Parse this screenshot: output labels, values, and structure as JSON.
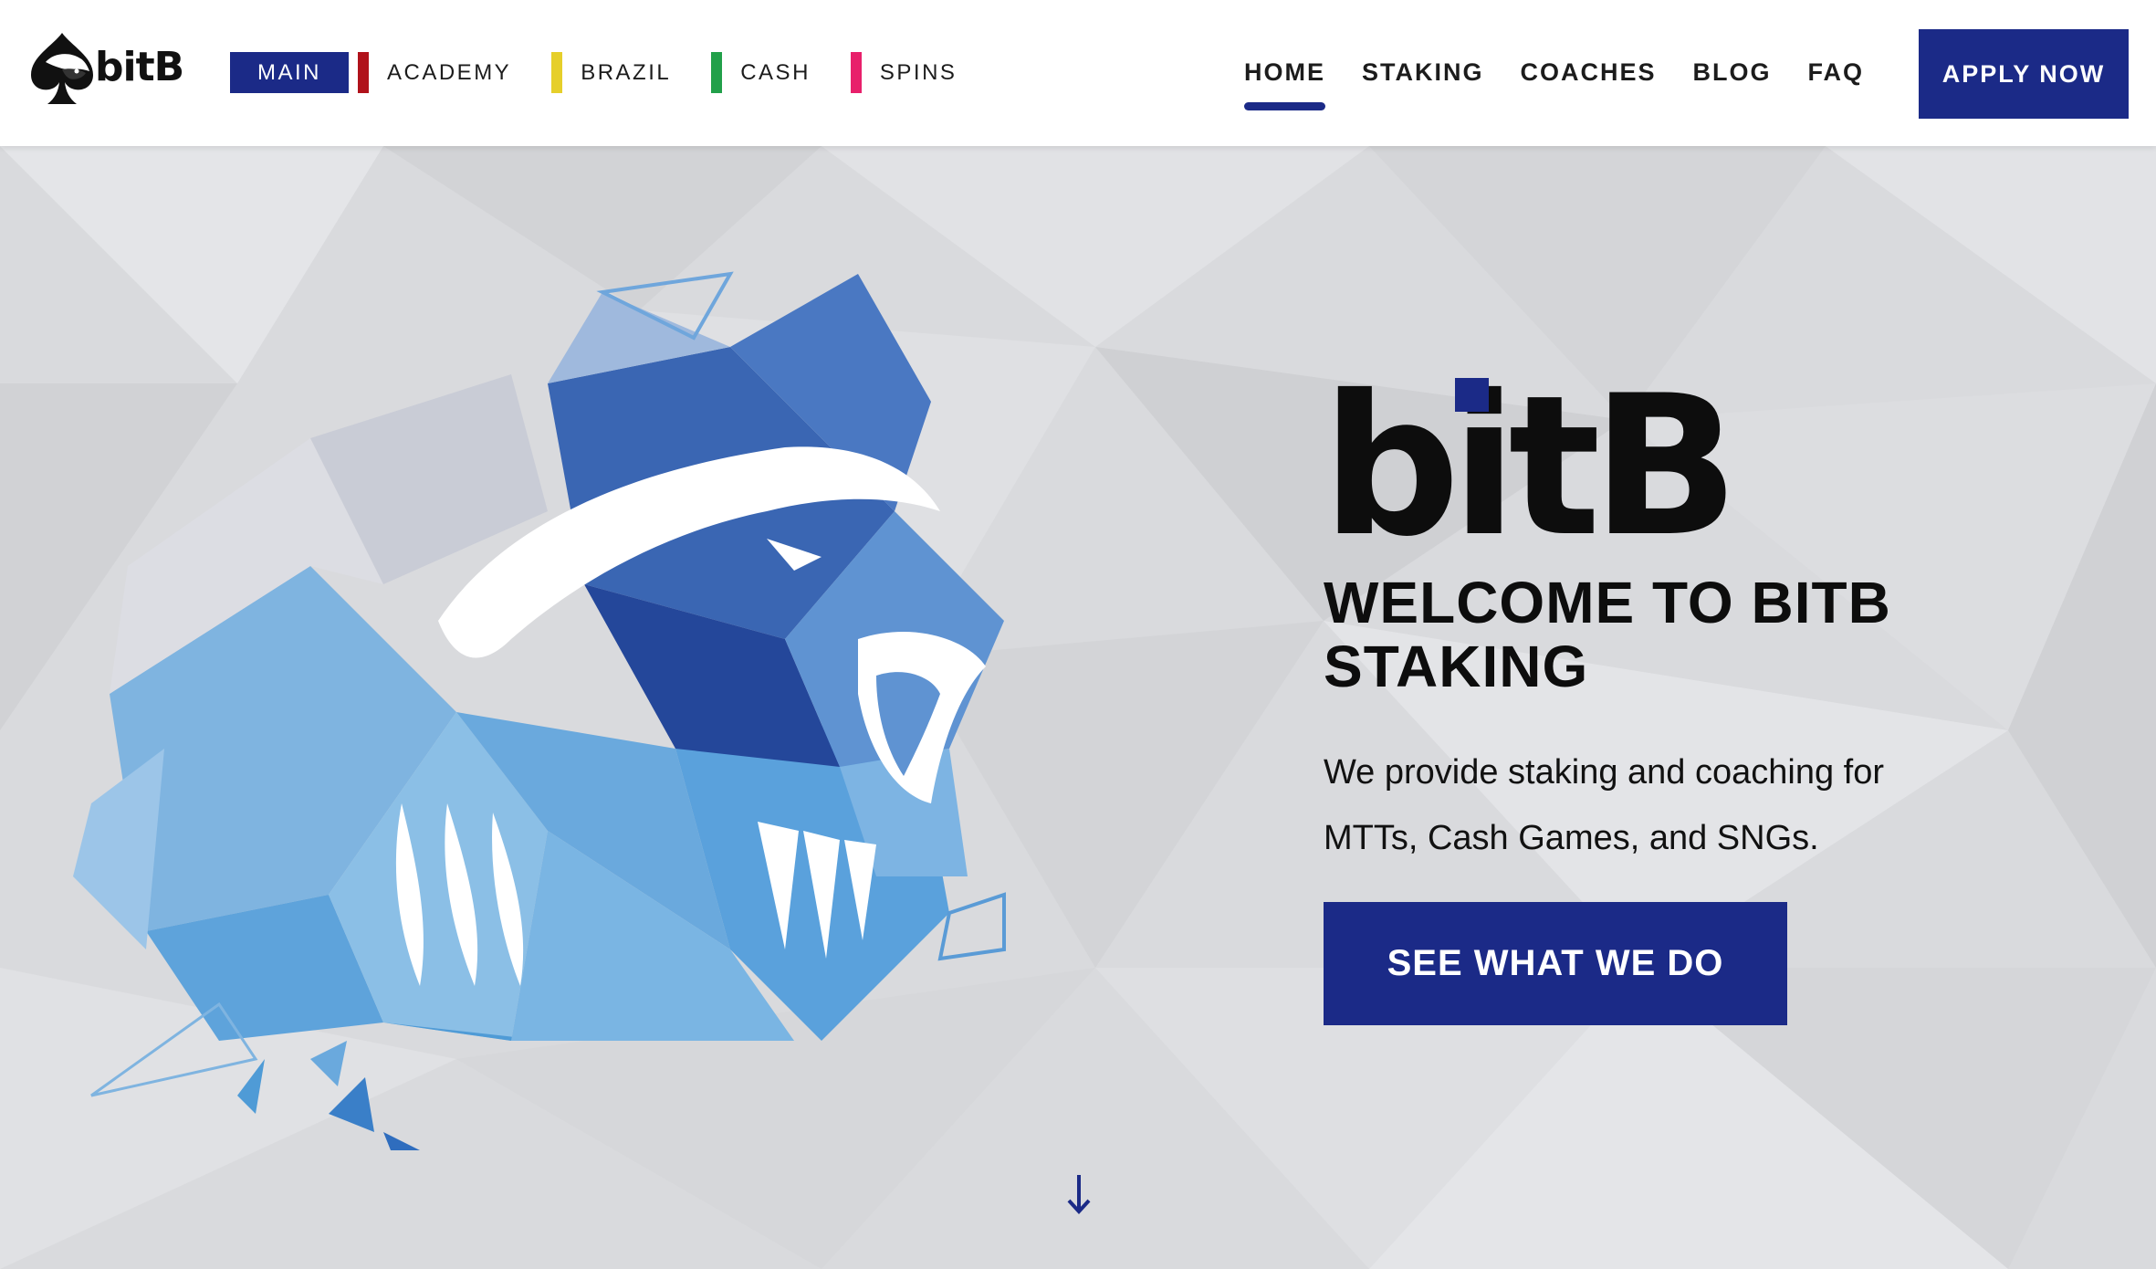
{
  "logo": {
    "text": "bitB",
    "icon": "spade-badger-icon"
  },
  "site_tabs": [
    {
      "label": "MAIN",
      "active": true,
      "color": "#1b2a87"
    },
    {
      "label": "ACADEMY",
      "active": false,
      "color": "#b0121b"
    },
    {
      "label": "BRAZIL",
      "active": false,
      "color": "#e6cf2a"
    },
    {
      "label": "CASH",
      "active": false,
      "color": "#22a04a"
    },
    {
      "label": "SPINS",
      "active": false,
      "color": "#e8206b"
    }
  ],
  "nav": {
    "items": [
      {
        "label": "HOME",
        "active": true
      },
      {
        "label": "STAKING",
        "active": false
      },
      {
        "label": "COACHES",
        "active": false
      },
      {
        "label": "BLOG",
        "active": false
      },
      {
        "label": "FAQ",
        "active": false
      }
    ],
    "apply_label": "APPLY NOW"
  },
  "hero": {
    "wordmark": "bitB",
    "title": "WELCOME TO BITB STAKING",
    "subtitle": "We provide staking and coaching for MTTs, Cash Games, and SNGs.",
    "cta_label": "SEE WHAT WE DO",
    "scroll_icon": "arrow-down-icon",
    "mascot_icon": "honey-badger-mascot"
  },
  "colors": {
    "brand_navy": "#1b2a87",
    "text_dark": "#0d0d0d",
    "hero_bg": "#d9dadd"
  }
}
